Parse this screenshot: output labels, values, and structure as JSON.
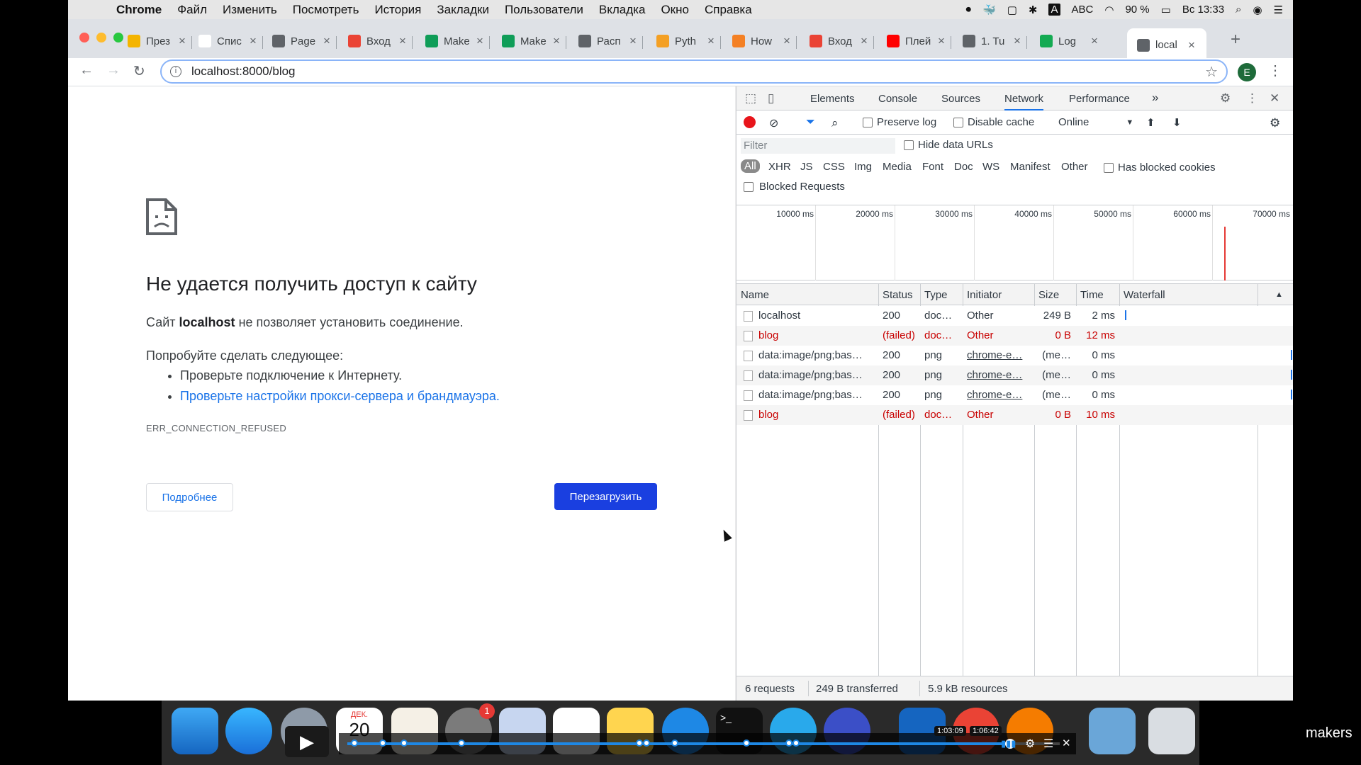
{
  "menubar": {
    "app": "Chrome",
    "items": [
      "Файл",
      "Изменить",
      "Посмотреть",
      "История",
      "Закладки",
      "Пользователи",
      "Вкладка",
      "Окно",
      "Справка"
    ],
    "battery": "90 %",
    "keyboard": "ABC",
    "clock": "Вс 13:33"
  },
  "tabs": [
    {
      "title": "През",
      "icon": "slides-icon",
      "color": "#f4b400"
    },
    {
      "title": "Спис",
      "icon": "wikipedia-icon",
      "color": "#ffffff"
    },
    {
      "title": "Page",
      "icon": "globe-icon",
      "color": "#5f6368"
    },
    {
      "title": "Вход",
      "icon": "gmail-icon",
      "color": "#ea4335"
    },
    {
      "title": "Make",
      "icon": "sheets-icon",
      "color": "#0f9d58"
    },
    {
      "title": "Make",
      "icon": "sheets-icon",
      "color": "#0f9d58"
    },
    {
      "title": "Расп",
      "icon": "globe-icon",
      "color": "#5f6368"
    },
    {
      "title": "Pyth",
      "icon": "python-icon",
      "color": "#f4a024"
    },
    {
      "title": "How",
      "icon": "stackoverflow-icon",
      "color": "#f48024"
    },
    {
      "title": "Вход",
      "icon": "gmail-icon",
      "color": "#ea4335"
    },
    {
      "title": "Плей",
      "icon": "youtube-icon",
      "color": "#ff0000"
    },
    {
      "title": "1. Tu",
      "icon": "book-icon",
      "color": "#5f6368"
    },
    {
      "title": "Log",
      "icon": "leaf-icon",
      "color": "#13aa52"
    },
    {
      "title": "local",
      "icon": "globe-icon",
      "color": "#5f6368"
    }
  ],
  "address": {
    "url": "localhost:8000/blog"
  },
  "profile": "E",
  "error_page": {
    "title": "Не удается получить доступ к сайту",
    "desc_prefix": "Сайт",
    "desc_host": "localhost",
    "desc_suffix": "не позволяет установить соединение.",
    "try_label": "Попробуйте сделать следующее:",
    "suggestions": [
      "Проверьте подключение к Интернету.",
      "Проверьте настройки прокси-сервера и брандмауэра."
    ],
    "error_code": "ERR_CONNECTION_REFUSED",
    "details_button": "Подробнее",
    "reload_button": "Перезагрузить"
  },
  "devtools": {
    "tabs": [
      "Elements",
      "Console",
      "Sources",
      "Network",
      "Performance"
    ],
    "active_tab": "Network",
    "more": "»",
    "toolbar": {
      "preserve_log": "Preserve log",
      "disable_cache": "Disable cache",
      "throttle": "Online"
    },
    "filter_placeholder": "Filter",
    "hide_data_urls": "Hide data URLs",
    "types": [
      "All",
      "XHR",
      "JS",
      "CSS",
      "Img",
      "Media",
      "Font",
      "Doc",
      "WS",
      "Manifest",
      "Other"
    ],
    "has_blocked_cookies": "Has blocked cookies",
    "blocked_requests": "Blocked Requests",
    "overview_ticks": [
      "10000 ms",
      "20000 ms",
      "30000 ms",
      "40000 ms",
      "50000 ms",
      "60000 ms",
      "70000 ms"
    ],
    "columns": [
      "Name",
      "Status",
      "Type",
      "Initiator",
      "Size",
      "Time",
      "Waterfall"
    ],
    "rows": [
      {
        "name": "localhost",
        "status": "200",
        "type": "doc…",
        "initiator": "Other",
        "size": "249 B",
        "time": "2 ms",
        "failed": false
      },
      {
        "name": "blog",
        "status": "(failed)",
        "type": "doc…",
        "initiator": "Other",
        "size": "0 B",
        "time": "12 ms",
        "failed": true
      },
      {
        "name": "data:image/png;bas…",
        "status": "200",
        "type": "png",
        "initiator": "chrome-e…",
        "size": "(me…",
        "time": "0 ms",
        "failed": false
      },
      {
        "name": "data:image/png;bas…",
        "status": "200",
        "type": "png",
        "initiator": "chrome-e…",
        "size": "(me…",
        "time": "0 ms",
        "failed": false
      },
      {
        "name": "data:image/png;bas…",
        "status": "200",
        "type": "png",
        "initiator": "chrome-e…",
        "size": "(me…",
        "time": "0 ms",
        "failed": false
      },
      {
        "name": "blog",
        "status": "(failed)",
        "type": "doc…",
        "initiator": "Other",
        "size": "0 B",
        "time": "10 ms",
        "failed": true
      }
    ],
    "status": {
      "requests": "6 requests",
      "transferred": "249 B transferred",
      "resources": "5.9 kB resources"
    }
  },
  "video": {
    "time_current": "1:03:09",
    "time_total": "1:06:42",
    "progress": 0.93,
    "calendar_month": "ДЕК.",
    "calendar_day": "20",
    "badge": "1"
  },
  "watermark": "makers"
}
